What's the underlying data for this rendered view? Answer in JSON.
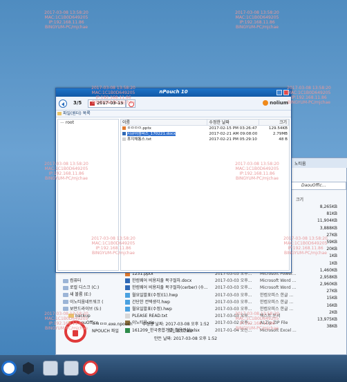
{
  "watermark": {
    "timestamp": "2017-03-08 13:58:20",
    "mac": "MAC:1C1B0D649205",
    "ip": "IP:192.168.11.86",
    "host": "BINGYUM-PC/mjchae"
  },
  "npouch": {
    "title": "nPouch 10",
    "page_indicator": "3/5",
    "date": "2017-03-15",
    "brand": "nolium",
    "path": "파일(원터) 목록",
    "tree_root": "root",
    "columns": {
      "name": "이름",
      "date": "수정한 날짜",
      "size": "크기"
    },
    "files": [
      {
        "name": "ㅁㅁㅁㅁ.pptx",
        "date": "2017-02-15 PM 03:26:47",
        "size": "129.54KB",
        "kind": "ppt"
      },
      {
        "name": "시큐어캠퍼스_170221.docx",
        "date": "2017-02-21 AM 09:08:00",
        "size": "2.79MB",
        "kind": "doc",
        "selected": true
      },
      {
        "name": "휴지채통스.txt",
        "date": "2017-02-21 PM 05:29:10",
        "size": "48 B",
        "kind": "txt"
      }
    ]
  },
  "explorer": {
    "topbar_label": "노티움",
    "address": "DaouOffic...",
    "size_header": "크기",
    "sizes": [
      "8,265KB",
      "81KB",
      "11,904KB",
      "3,888KB",
      "27KB",
      "59KB",
      "20KB",
      "1KB",
      "1KB",
      "1,460KB",
      "2,958KB",
      "2,960KB",
      "27KB",
      "15KB",
      "16KB",
      "2KB",
      "13,975KB",
      "38KB"
    ],
    "tree": [
      {
        "label": "컴퓨터",
        "type": "pc"
      },
      {
        "label": "로컬 디스크 (C:)",
        "type": "drive"
      },
      {
        "label": "새 볼륨 (E:)",
        "type": "drive"
      },
      {
        "label": "이노티움네트워크 (",
        "type": "drive"
      },
      {
        "label": "보안드라이브 (S:)",
        "type": "drive"
      },
      {
        "label": "backup",
        "type": "folder"
      },
      {
        "label": "DaouOffice",
        "type": "folder"
      },
      {
        "label": "doc",
        "type": "folder"
      }
    ],
    "files": [
      {
        "name": "1231.pptx",
        "date": "2017-03-03 오후...",
        "type": "Microsoft Power...",
        "size": "1,460KB",
        "kind": "ppt"
      },
      {
        "name": "한컴웨어 비용지출 복구절차.docx",
        "date": "2017-03-03 오후...",
        "type": "Microsoft Word ...",
        "size": "2,958KB",
        "kind": "doc"
      },
      {
        "name": "한컴웨어 비용지출 복구절차(cerber) (수...",
        "date": "2017-03-03 오후...",
        "type": "Microsoft Word ...",
        "size": "2,960KB",
        "kind": "doc"
      },
      {
        "name": "월요일발표(수정)(1).hwp",
        "date": "2017-03-03 오후...",
        "type": "한컴오피스 한글 ...",
        "size": "27KB",
        "kind": "hwp"
      },
      {
        "name": "간단한 컨텍생각.hwp",
        "date": "2017-03-03 오후...",
        "type": "한컴오피스 한글 ...",
        "size": "15KB",
        "kind": "hwp"
      },
      {
        "name": "월요일발표(수정).hwp",
        "date": "2017-03-03 오후...",
        "type": "한컴오피스 한글 ...",
        "size": "16KB",
        "kind": "hwp"
      },
      {
        "name": "PLEASE READ.txt",
        "date": "2017-03-03 오후...",
        "type": "텍스트 문서",
        "size": "2KB",
        "kind": "txt"
      },
      {
        "name": "이노티움.zip",
        "date": "2017-03-02 오후...",
        "type": "ALZip ZIP File",
        "size": "13,975KB",
        "kind": "zip"
      },
      {
        "name": "161209_한국중합기별_활용진실.xlsx",
        "date": "2017-01-04 오전...",
        "type": "Microsoft Excel ...",
        "size": "38KB",
        "kind": "xls"
      }
    ],
    "detail": {
      "filename": "ㅁㅁㅁㅁ.exe.npouch",
      "modified": "수정한 날짜: 2017-03-08 오후 1:52",
      "kind": "NPOUCH 파일",
      "size": "크기: 8.07MB",
      "created": "만든 날짜: 2017-03-08 오후 1:52"
    }
  }
}
